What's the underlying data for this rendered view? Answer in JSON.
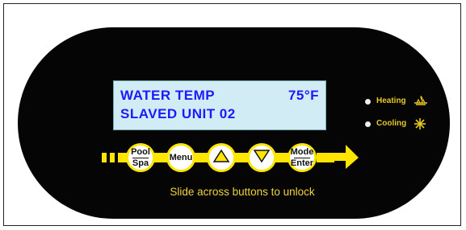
{
  "lcd": {
    "line1_left": "WATER TEMP",
    "line1_right": "75°F",
    "line2": "SLAVED  UNIT 02"
  },
  "indicators": {
    "heating": "Heating",
    "cooling": "Cooling"
  },
  "buttons": {
    "pool_spa_top": "Pool",
    "pool_spa_bottom": "Spa",
    "menu": "Menu",
    "up": "up-arrow-icon",
    "down": "down-arrow-icon",
    "mode_enter_top": "Mode",
    "mode_enter_bottom": "Enter"
  },
  "hint": "Slide across buttons to unlock",
  "colors": {
    "panel": "#050505",
    "lcd_background": "#d2ecf6",
    "lcd_text": "#1a1aff",
    "accent_yellow": "#ffe600"
  }
}
